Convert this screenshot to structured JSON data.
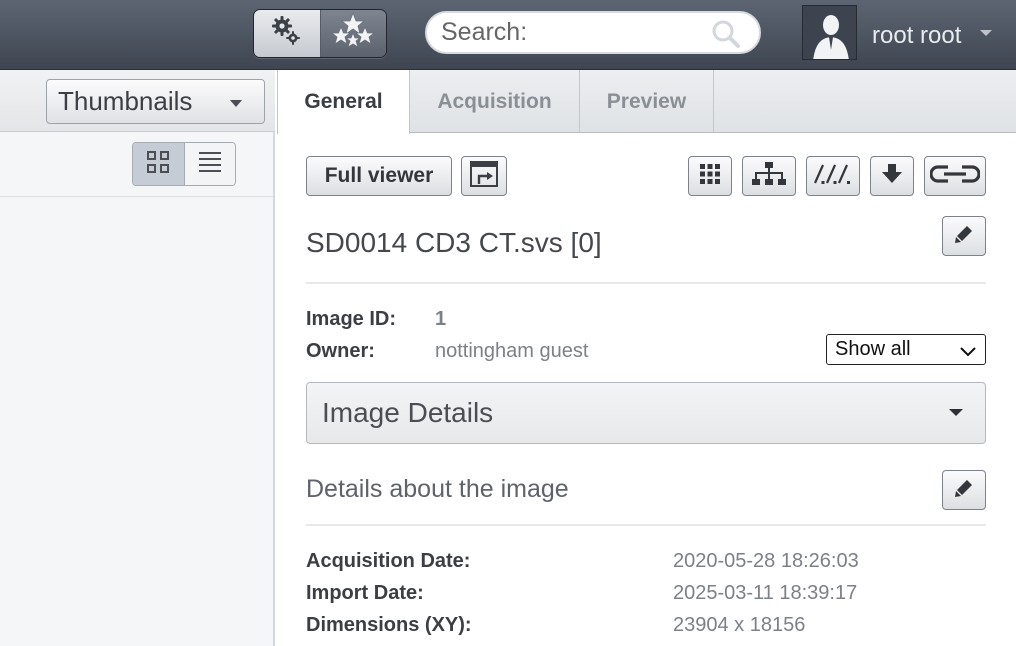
{
  "topbar": {
    "search_placeholder": "Search:",
    "username": "root root",
    "icons": [
      "gears-icon",
      "stars-icon",
      "magnifier-icon",
      "user-silhouette-icon",
      "caret-down-icon"
    ]
  },
  "left_panel": {
    "view_select": "Thumbnails",
    "view_modes": [
      "grid-view-icon",
      "list-view-icon"
    ]
  },
  "tabs": [
    {
      "label": "General",
      "active": true
    },
    {
      "label": "Acquisition",
      "active": false
    },
    {
      "label": "Preview",
      "active": false
    }
  ],
  "toolbar": {
    "full_viewer_label": "Full viewer",
    "icons": [
      "open-in-window-icon",
      "grid-icon",
      "hierarchy-icon",
      "path-link-icon",
      "download-icon",
      "link-icon",
      "edit-pencil-icon"
    ]
  },
  "image": {
    "title": "SD0014 CD3 CT.svs [0]",
    "id_label": "Image ID:",
    "id_value": "1",
    "owner_label": "Owner:",
    "owner_value": "nottingham guest",
    "filter_value": "Show all"
  },
  "details": {
    "section_title": "Image Details",
    "description": "Details about the image",
    "rows": [
      {
        "label": "Acquisition Date:",
        "value": "2020-05-28 18:26:03"
      },
      {
        "label": "Import Date:",
        "value": "2025-03-11 18:39:17"
      },
      {
        "label": "Dimensions (XY):",
        "value": "23904 x 18156"
      }
    ]
  },
  "colors": {
    "topbar": "#4a515d",
    "panel_bg": "#f5f6f7",
    "muted_text": "#7c8187"
  }
}
